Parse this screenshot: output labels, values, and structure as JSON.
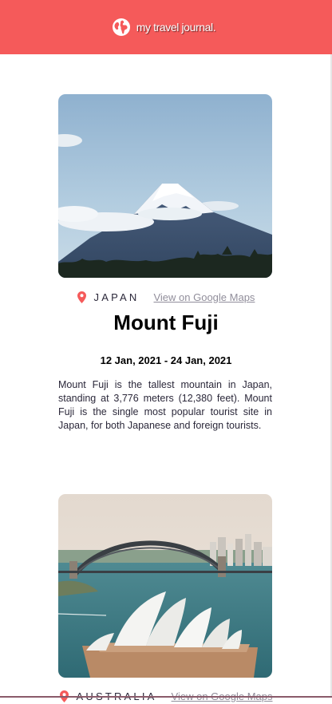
{
  "header": {
    "brand": "my travel journal."
  },
  "entries": [
    {
      "country": "JAPAN",
      "maps_link": "View on Google Maps",
      "title": "Mount Fuji",
      "dates": "12 Jan, 2021 - 24 Jan, 2021",
      "description": "Mount Fuji is the tallest mountain in Japan, standing at 3,776 meters (12,380 feet). Mount Fuji is the single most popular tourist site in Japan, for both Japanese and foreign tourists."
    },
    {
      "country": "AUSTRALIA",
      "maps_link": "View on Google Maps"
    }
  ],
  "colors": {
    "accent": "#f55a5a",
    "text": "#2b283a",
    "muted": "#918e9b"
  },
  "icons": {
    "logo": "globe-icon",
    "location": "location-pin-icon"
  }
}
